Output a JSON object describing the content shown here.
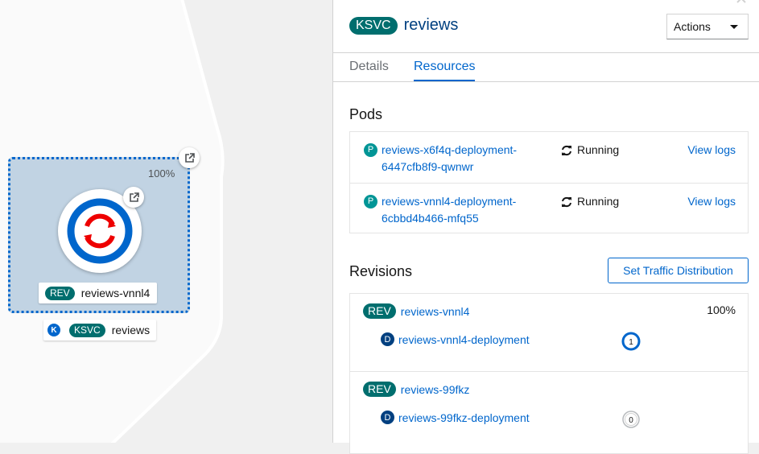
{
  "topology": {
    "traffic_percent": "100%",
    "revision_node": {
      "badge": "REV",
      "name": "reviews-vnnl4"
    },
    "service_node": {
      "k_letter": "K",
      "badge": "KSVC",
      "name": "reviews"
    }
  },
  "panel": {
    "badge": "KSVC",
    "title": "reviews",
    "actions_label": "Actions",
    "tabs": [
      {
        "label": "Details",
        "active": false
      },
      {
        "label": "Resources",
        "active": true
      }
    ],
    "pods_title": "Pods",
    "pods": [
      {
        "badge": "P",
        "name_line1": "reviews-x6f4q-deployment-",
        "name_line2": "6447cfb8f9-qwnwr",
        "status": "Running",
        "logs_label": "View logs"
      },
      {
        "badge": "P",
        "name_line1": "reviews-vnnl4-deployment-",
        "name_line2": "6cbbd4b466-mfq55",
        "status": "Running",
        "logs_label": "View logs"
      }
    ],
    "revisions_title": "Revisions",
    "traffic_button": "Set Traffic Distribution",
    "revisions": [
      {
        "badge": "REV",
        "name": "reviews-vnnl4",
        "percent": "100%",
        "dep_badge": "D",
        "deployment": "reviews-vnnl4-deployment",
        "pod_count": "1"
      },
      {
        "badge": "REV",
        "name": "reviews-99fkz",
        "percent": "",
        "dep_badge": "D",
        "deployment": "reviews-99fkz-deployment",
        "pod_count": "0"
      }
    ]
  },
  "colors": {
    "accent": "#0066cc",
    "badge_teal": "#006e6e",
    "pod_badge": "#009596",
    "dep_badge": "#004080",
    "openshift_red": "#ee0000"
  }
}
